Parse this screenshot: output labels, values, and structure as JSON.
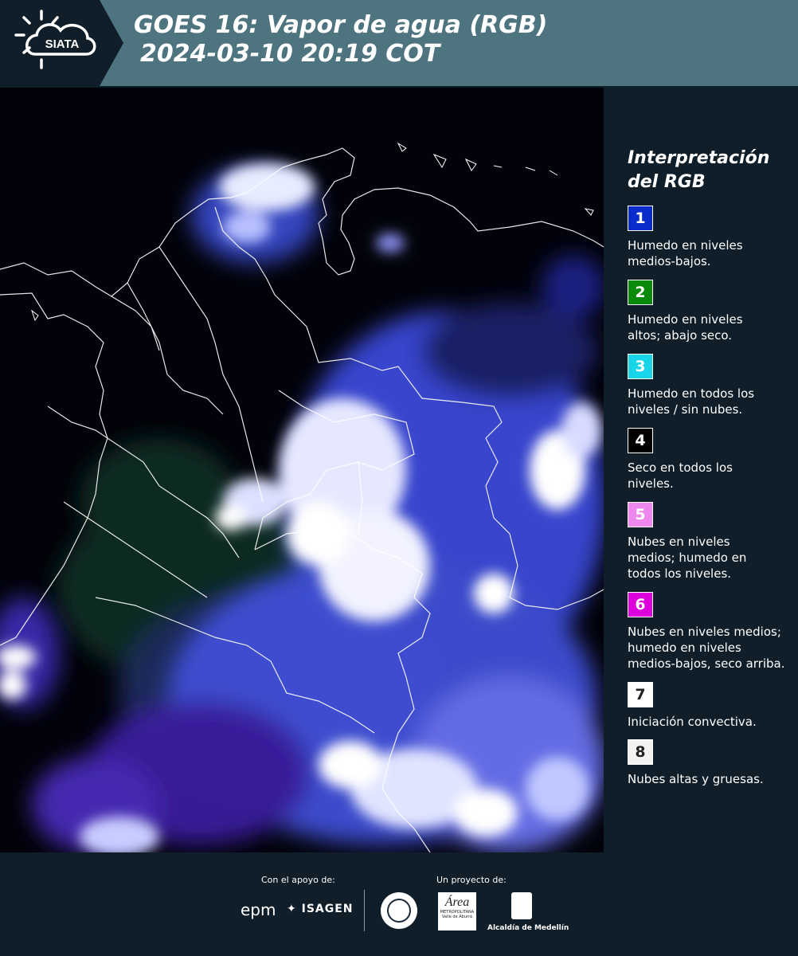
{
  "header": {
    "logo_text": "SIATA",
    "title_line1": "GOES 16: Vapor de agua (RGB)",
    "title_line2": "2024-03-10 20:19 COT"
  },
  "legend": {
    "title_line1": "Interpretación",
    "title_line2": "del RGB",
    "items": [
      {
        "number": "1",
        "color": "#0a2ccc",
        "text_color": "#ffffff",
        "line1": "Humedo en niveles",
        "line2": "medios-bajos.",
        "line3": ""
      },
      {
        "number": "2",
        "color": "#0a8a0a",
        "text_color": "#ffffff",
        "line1": "Humedo en niveles",
        "line2": "altos; abajo seco.",
        "line3": ""
      },
      {
        "number": "3",
        "color": "#18d6ea",
        "text_color": "#ffffff",
        "line1": "Humedo en todos los",
        "line2": "niveles / sin nubes.",
        "line3": ""
      },
      {
        "number": "4",
        "color": "#000000",
        "text_color": "#ffffff",
        "line1": "Seco en todos los",
        "line2": "niveles.",
        "line3": ""
      },
      {
        "number": "5",
        "color": "#ee88ee",
        "text_color": "#ffffff",
        "line1": "Nubes en niveles",
        "line2": "medios; humedo en",
        "line3": "todos los niveles."
      },
      {
        "number": "6",
        "color": "#dd00dd",
        "text_color": "#ffffff",
        "line1": "Nubes en niveles medios;",
        "line2": "humedo en niveles",
        "line3": "medios-bajos, seco arriba."
      },
      {
        "number": "7",
        "color": "#ffffff",
        "text_color": "#222222",
        "line1": "Iniciación convectiva.",
        "line2": "",
        "line3": ""
      },
      {
        "number": "8",
        "color": "#f2f2f2",
        "text_color": "#222222",
        "line1": "Nubes altas y gruesas.",
        "line2": "",
        "line3": ""
      }
    ]
  },
  "footer": {
    "support_label": "Con el apoyo de:",
    "project_label": "Un proyecto de:",
    "sponsor1": "epm",
    "sponsor2": "ISAGEN",
    "partner1_line1": "Área",
    "partner1_line2": "METROPOLITANA",
    "partner1_line3": "Valle de Aburrá",
    "partner2": "Alcaldía de Medellín"
  },
  "colors": {
    "header_bg": "#4e7480",
    "page_bg": "#0f1e29",
    "map_bg": "#02030a"
  }
}
